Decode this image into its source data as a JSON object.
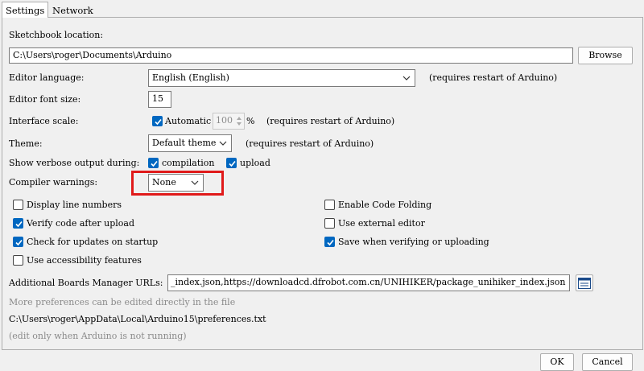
{
  "tabs": [
    {
      "label": "Settings"
    },
    {
      "label": "Network"
    }
  ],
  "sketchbook": {
    "label": "Sketchbook location:",
    "path": "C:\\Users\\roger\\Documents\\Arduino",
    "browse": "Browse"
  },
  "editor_language": {
    "label": "Editor language:",
    "value": "English (English)",
    "note": "(requires restart of Arduino)"
  },
  "font_size": {
    "label": "Editor font size:",
    "value": "15"
  },
  "interface_scale": {
    "label": "Interface scale:",
    "auto_label": "Automatic",
    "auto_checked": true,
    "value": "100",
    "unit": "%",
    "note": "(requires restart of Arduino)"
  },
  "theme": {
    "label": "Theme:",
    "value": "Default theme",
    "note": "(requires restart of Arduino)"
  },
  "verbose": {
    "label": "Show verbose output during:",
    "compilation": "compilation",
    "compilation_checked": true,
    "upload": "upload",
    "upload_checked": true
  },
  "compiler_warnings": {
    "label": "Compiler warnings:",
    "value": "None"
  },
  "options": {
    "display_line_numbers": {
      "label": "Display line numbers",
      "checked": false
    },
    "enable_code_folding": {
      "label": "Enable Code Folding",
      "checked": false
    },
    "verify_after_upload": {
      "label": "Verify code after upload",
      "checked": true
    },
    "use_external_editor": {
      "label": "Use external editor",
      "checked": false
    },
    "check_updates": {
      "label": "Check for updates on startup",
      "checked": true
    },
    "save_when_verifying": {
      "label": "Save when verifying or uploading",
      "checked": true
    },
    "accessibility": {
      "label": "Use accessibility features",
      "checked": false
    }
  },
  "boards_manager": {
    "label": "Additional Boards Manager URLs:",
    "value": "_index.json,https://downloadcd.dfrobot.com.cn/UNIHIKER/package_unihiker_index.json"
  },
  "footer": {
    "more_prefs": "More preferences can be edited directly in the file",
    "prefs_path": "C:\\Users\\roger\\AppData\\Local\\Arduino15\\preferences.txt",
    "edit_note": "(edit only when Arduino is not running)"
  },
  "buttons": {
    "ok": "OK",
    "cancel": "Cancel"
  },
  "colors": {
    "accent": "#0067c0",
    "highlight": "#e01a1a"
  }
}
